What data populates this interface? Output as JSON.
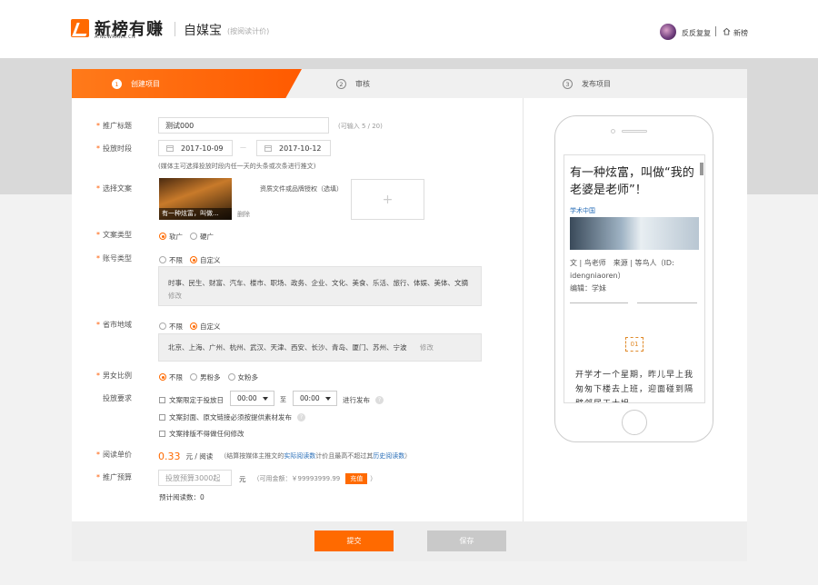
{
  "header": {
    "logo_text": "新榜有赚",
    "logo_sub": "A.NEWRANK.CN",
    "product": "自媒宝",
    "product_note": "(按阅读计价)",
    "user_name": "反反复复",
    "home_label": "新榜"
  },
  "steps": [
    {
      "num": "1",
      "label": "创建项目"
    },
    {
      "num": "2",
      "label": "审核"
    },
    {
      "num": "3",
      "label": "发布项目"
    }
  ],
  "form": {
    "title": {
      "label": "推广标题",
      "value": "测试000",
      "hint": "(可输入 5 / 20)"
    },
    "period": {
      "label": "投放时段",
      "start": "2017-10-09",
      "dash": "—",
      "end": "2017-10-12",
      "hint": "(媒体主可选择投放时段内任一天的头条或次条进行推文)"
    },
    "article": {
      "label": "选择文案",
      "thumb_caption": "有一种炫富，叫做...",
      "delete": "删除",
      "license_label": "资质文件或品牌授权（选填）",
      "plus": "+"
    },
    "type": {
      "label": "文案类型",
      "options": [
        "软广",
        "硬广"
      ]
    },
    "account_type": {
      "label": "账号类型",
      "options": [
        "不限",
        "自定义"
      ],
      "tags": "时事、民生、财富、汽车、楼市、职场、政务、企业、文化、美食、乐活、旅行、体娱、美体、文摘",
      "edit": "修改"
    },
    "region": {
      "label": "省市地域",
      "options": [
        "不限",
        "自定义"
      ],
      "tags": "北京、上海、广州、杭州、武汉、天津、西安、长沙、青岛、厦门、苏州、宁波",
      "edit": "修改"
    },
    "gender": {
      "label": "男女比例",
      "options": [
        "不限",
        "男粉多",
        "女粉多"
      ]
    },
    "delivery": {
      "label": "投放要求",
      "check1": "文案限定于投放日",
      "time_start": "00:00",
      "to": "至",
      "time_end": "00:00",
      "after": "进行发布",
      "check2": "文案封面、原文链接必须按提供素材发布",
      "check3": "文案排版不得做任何修改",
      "help": "?"
    },
    "price": {
      "label": "阅读单价",
      "value": "0.33",
      "unit": "元 / 阅读",
      "note_pre": "（结算按媒体主推文的",
      "link1": "实际阅读数",
      "note_mid": "计价且最高不超过其",
      "link2": "历史阅读数",
      "note_post": "）"
    },
    "budget": {
      "label": "推广预算",
      "placeholder": "投放预算3000起",
      "unit": "元",
      "balance_pre": "（可用金额：￥99993999.99",
      "recharge": "充值",
      "balance_post": "）",
      "estimate": "预计阅读数：0"
    }
  },
  "buttons": {
    "submit": "提交",
    "save": "保存"
  },
  "preview": {
    "title": "有一种炫富，叫做“我的老婆是老师”！",
    "source": "学术中国",
    "meta": "文 | 鸟老师　来源 | 等鸟人（ID: idengniaoren）",
    "editor": "编辑：学妹",
    "badge": "01",
    "body": "开学才一个星期，昨儿早上我匆匆下楼去上班，迎面碰到隔壁邻居王大姐"
  },
  "colors": {
    "accent": "#ff6a00",
    "link": "#2a6fb8"
  }
}
